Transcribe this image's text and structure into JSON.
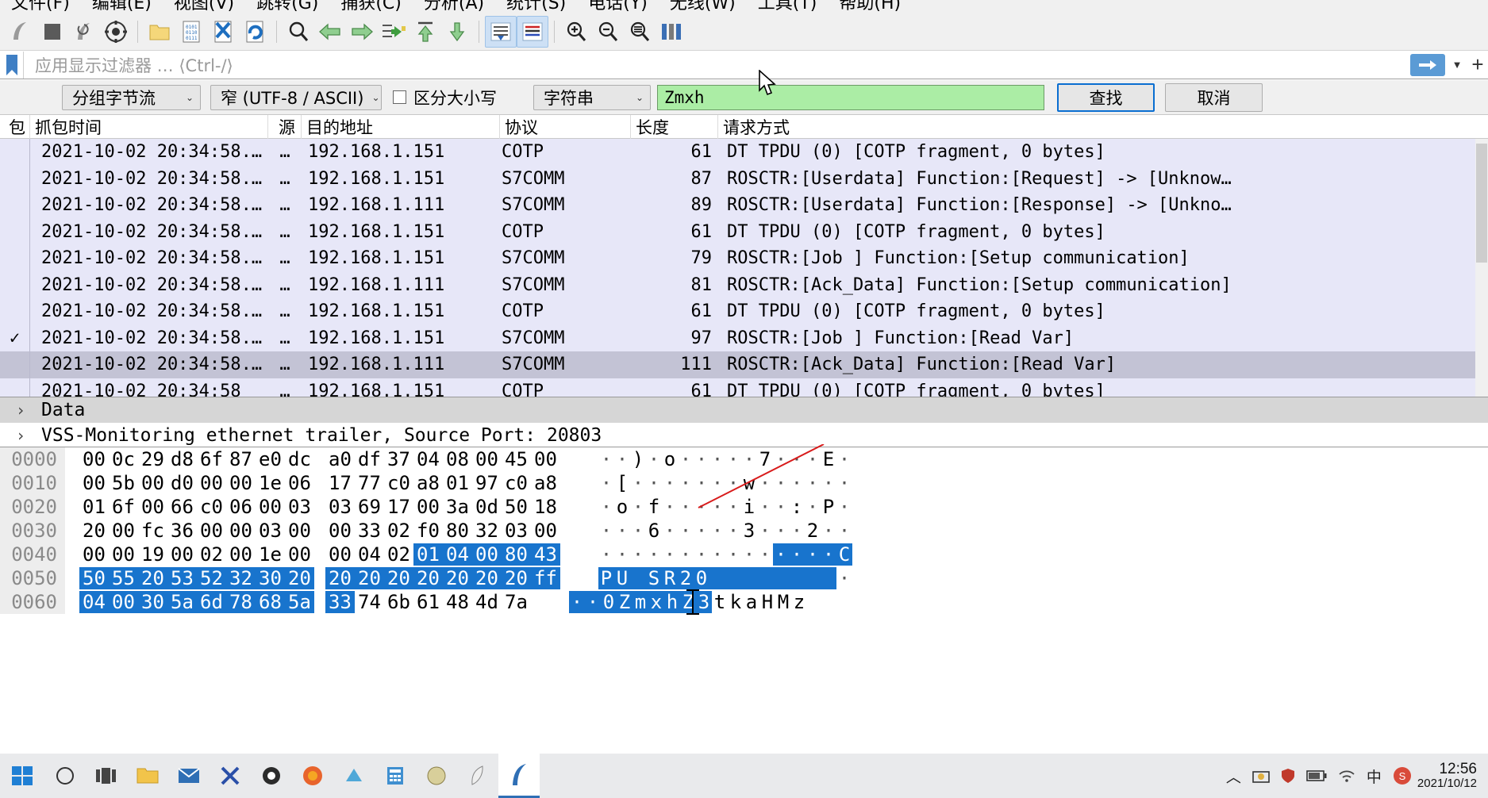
{
  "menu": {
    "items": [
      {
        "label": "文件(F)"
      },
      {
        "label": "编辑(E)"
      },
      {
        "label": "视图(V)"
      },
      {
        "label": "跳转(G)"
      },
      {
        "label": "捕获(C)"
      },
      {
        "label": "分析(A)"
      },
      {
        "label": "统计(S)"
      },
      {
        "label": "电话(Y)"
      },
      {
        "label": "无线(W)"
      },
      {
        "label": "工具(T)"
      },
      {
        "label": "帮助(H)"
      }
    ]
  },
  "toolbar": {
    "buttons": [
      {
        "name": "start-capture-icon",
        "glyph": "shark-fin"
      },
      {
        "name": "stop-capture-icon",
        "glyph": "stop"
      },
      {
        "name": "restart-capture-icon",
        "glyph": "restart"
      },
      {
        "name": "capture-options-icon",
        "glyph": "gear"
      },
      {
        "name": "open-file-icon",
        "glyph": "folder"
      },
      {
        "name": "save-file-icon",
        "glyph": "save"
      },
      {
        "name": "close-file-icon",
        "glyph": "close-x"
      },
      {
        "name": "reload-file-icon",
        "glyph": "reload"
      },
      {
        "name": "find-packet-icon",
        "glyph": "magnifier"
      },
      {
        "name": "go-back-icon",
        "glyph": "arrow-left"
      },
      {
        "name": "go-forward-icon",
        "glyph": "arrow-right"
      },
      {
        "name": "go-to-packet-icon",
        "glyph": "goto"
      },
      {
        "name": "go-first-packet-icon",
        "glyph": "arrow-up-bar"
      },
      {
        "name": "go-last-packet-icon",
        "glyph": "arrow-down"
      },
      {
        "name": "auto-scroll-icon",
        "glyph": "autoscroll"
      },
      {
        "name": "colorize-icon",
        "glyph": "colorize"
      },
      {
        "name": "zoom-in-icon",
        "glyph": "zoom-in"
      },
      {
        "name": "zoom-out-icon",
        "glyph": "zoom-out"
      },
      {
        "name": "zoom-reset-icon",
        "glyph": "zoom-reset"
      },
      {
        "name": "resize-columns-icon",
        "glyph": "columns"
      }
    ]
  },
  "filter": {
    "placeholder": "应用显示过滤器 … ⟨Ctrl-/⟩",
    "value": ""
  },
  "find": {
    "search_in_label": "分组字节流",
    "charset_label": "窄 (UTF-8 / ASCII)",
    "case_sensitive_label": "区分大小写",
    "case_sensitive_checked": false,
    "value_type_label": "字符串",
    "query": "Zmxh",
    "find_button": "查找",
    "cancel_button": "取消",
    "field_bg": "#abeda5"
  },
  "packet_list": {
    "columns": [
      "包",
      "抓包时间",
      "源",
      "目的地址",
      "协议",
      "长度",
      "请求方式"
    ],
    "rows": [
      {
        "time": "2021-10-02 20:34:58.…",
        "src": "…",
        "dst": "192.168.1.151",
        "proto": "COTP",
        "len": "61",
        "info": "DT TPDU (0) [COTP fragment, 0 bytes]",
        "selected": false,
        "mark": ""
      },
      {
        "time": "2021-10-02 20:34:58.…",
        "src": "…",
        "dst": "192.168.1.151",
        "proto": "S7COMM",
        "len": "87",
        "info": "ROSCTR:[Userdata] Function:[Request] -> [Unknow…",
        "selected": false,
        "mark": ""
      },
      {
        "time": "2021-10-02 20:34:58.…",
        "src": "…",
        "dst": "192.168.1.111",
        "proto": "S7COMM",
        "len": "89",
        "info": "ROSCTR:[Userdata] Function:[Response] -> [Unkno…",
        "selected": false,
        "mark": ""
      },
      {
        "time": "2021-10-02 20:34:58.…",
        "src": "…",
        "dst": "192.168.1.151",
        "proto": "COTP",
        "len": "61",
        "info": "DT TPDU (0) [COTP fragment, 0 bytes]",
        "selected": false,
        "mark": ""
      },
      {
        "time": "2021-10-02 20:34:58.…",
        "src": "…",
        "dst": "192.168.1.151",
        "proto": "S7COMM",
        "len": "79",
        "info": "ROSCTR:[Job     ] Function:[Setup communication]",
        "selected": false,
        "mark": ""
      },
      {
        "time": "2021-10-02 20:34:58.…",
        "src": "…",
        "dst": "192.168.1.111",
        "proto": "S7COMM",
        "len": "81",
        "info": "ROSCTR:[Ack_Data] Function:[Setup communication]",
        "selected": false,
        "mark": ""
      },
      {
        "time": "2021-10-02 20:34:58.…",
        "src": "…",
        "dst": "192.168.1.151",
        "proto": "COTP",
        "len": "61",
        "info": "DT TPDU (0) [COTP fragment, 0 bytes]",
        "selected": false,
        "mark": ""
      },
      {
        "time": "2021-10-02 20:34:58.…",
        "src": "…",
        "dst": "192.168.1.151",
        "proto": "S7COMM",
        "len": "97",
        "info": "ROSCTR:[Job     ] Function:[Read Var]",
        "selected": false,
        "mark": "✓"
      },
      {
        "time": "2021-10-02 20:34:58.…",
        "src": "…",
        "dst": "192.168.1.111",
        "proto": "S7COMM",
        "len": "111",
        "info": "ROSCTR:[Ack_Data] Function:[Read Var]",
        "selected": true,
        "mark": ""
      },
      {
        "time": "2021-10-02 20:34:58",
        "src": "…",
        "dst": "192.168.1.151",
        "proto": "COTP",
        "len": "61",
        "info": "DT TPDU (0) [COTP fragment, 0 bytes]",
        "selected": false,
        "mark": ""
      }
    ]
  },
  "packet_detail": {
    "rows": [
      {
        "arrow": "›",
        "label": "Data",
        "selected": true
      },
      {
        "arrow": "›",
        "label": "VSS-Monitoring ethernet trailer, Source Port: 20803",
        "selected": false
      }
    ]
  },
  "hex_dump": {
    "rows": [
      {
        "offset": "0000",
        "bytes": [
          "00",
          "0c",
          "29",
          "d8",
          "6f",
          "87",
          "e0",
          "dc",
          "a0",
          "df",
          "37",
          "04",
          "08",
          "00",
          "45",
          "00"
        ],
        "hl": [],
        "ascii": [
          "·",
          "·",
          ")",
          "·",
          "o",
          "·",
          "·",
          "·",
          "·",
          "·",
          "7",
          "·",
          "·",
          "·",
          "E",
          "·"
        ],
        "ascii_hl": []
      },
      {
        "offset": "0010",
        "bytes": [
          "00",
          "5b",
          "00",
          "d0",
          "00",
          "00",
          "1e",
          "06",
          "17",
          "77",
          "c0",
          "a8",
          "01",
          "97",
          "c0",
          "a8"
        ],
        "hl": [],
        "ascii": [
          "·",
          "[",
          "·",
          "·",
          "·",
          "·",
          "·",
          "·",
          "·",
          "w",
          "·",
          "·",
          "·",
          "·",
          "·",
          "·"
        ],
        "ascii_hl": []
      },
      {
        "offset": "0020",
        "bytes": [
          "01",
          "6f",
          "00",
          "66",
          "c0",
          "06",
          "00",
          "03",
          "03",
          "69",
          "17",
          "00",
          "3a",
          "0d",
          "50",
          "18"
        ],
        "hl": [],
        "ascii": [
          "·",
          "o",
          "·",
          "f",
          "·",
          "·",
          "·",
          "·",
          "·",
          "i",
          "·",
          "·",
          ":",
          "·",
          "P",
          "·"
        ],
        "ascii_hl": []
      },
      {
        "offset": "0030",
        "bytes": [
          "20",
          "00",
          "fc",
          "36",
          "00",
          "00",
          "03",
          "00",
          "00",
          "33",
          "02",
          "f0",
          "80",
          "32",
          "03",
          "00"
        ],
        "hl": [],
        "ascii": [
          "·",
          "·",
          "·",
          "6",
          "·",
          "·",
          "·",
          "·",
          "·",
          "3",
          "·",
          "·",
          "·",
          "2",
          "·",
          "·"
        ],
        "ascii_hl": []
      },
      {
        "offset": "0040",
        "bytes": [
          "00",
          "00",
          "19",
          "00",
          "02",
          "00",
          "1e",
          "00",
          "00",
          "04",
          "02",
          "01",
          "04",
          "00",
          "80",
          "43"
        ],
        "hl": [
          11,
          12,
          13,
          14,
          15
        ],
        "ascii": [
          "·",
          "·",
          "·",
          "·",
          "·",
          "·",
          "·",
          "·",
          "·",
          "·",
          "·",
          "·",
          "·",
          "·",
          "·",
          "C"
        ],
        "ascii_hl": [
          11,
          12,
          13,
          14,
          15
        ]
      },
      {
        "offset": "0050",
        "bytes": [
          "50",
          "55",
          "20",
          "53",
          "52",
          "32",
          "30",
          "20",
          "20",
          "20",
          "20",
          "20",
          "20",
          "20",
          "20",
          "ff"
        ],
        "hl": [
          0,
          1,
          2,
          3,
          4,
          5,
          6,
          7,
          8,
          9,
          10,
          11,
          12,
          13,
          14,
          15
        ],
        "ascii": [
          "P",
          "U",
          " ",
          "S",
          "R",
          "2",
          "0",
          " ",
          " ",
          " ",
          " ",
          " ",
          " ",
          " ",
          " ",
          "·"
        ],
        "ascii_hl": [
          0,
          1,
          2,
          3,
          4,
          5,
          6,
          7,
          8,
          9,
          10,
          11,
          12,
          13,
          14
        ]
      },
      {
        "offset": "0060",
        "bytes": [
          "04",
          "00",
          "30",
          "5a",
          "6d",
          "78",
          "68",
          "5a",
          "33",
          "74",
          "6b",
          "61",
          "48",
          "4d",
          "7a"
        ],
        "hl": [
          0,
          1,
          2,
          3,
          4,
          5,
          6,
          7,
          8
        ],
        "boxed": [
          5
        ],
        "ascii": [
          "·",
          "·",
          "0",
          "Z",
          "m",
          "x",
          "h",
          "Z",
          "3",
          "t",
          "k",
          "a",
          "H",
          "M",
          "z"
        ],
        "ascii_hl": [
          0,
          1,
          2,
          3,
          4,
          5,
          6,
          7,
          8
        ]
      }
    ]
  },
  "taskbar": {
    "icons": [
      {
        "name": "start-button-icon"
      },
      {
        "name": "search-circle-icon"
      },
      {
        "name": "task-view-icon"
      },
      {
        "name": "file-explorer-icon"
      },
      {
        "name": "mail-icon"
      },
      {
        "name": "xmind-icon"
      },
      {
        "name": "github-desktop-icon"
      },
      {
        "name": "firefox-icon"
      },
      {
        "name": "notepad-icon"
      },
      {
        "name": "calculator-icon"
      },
      {
        "name": "photoshop-icon"
      },
      {
        "name": "feather-editor-icon"
      },
      {
        "name": "wireshark-icon"
      }
    ],
    "tray": {
      "chevron": "︿",
      "ime_label": "中",
      "sogou_label": "S",
      "time": "12:56",
      "date": "2021/10/12"
    }
  }
}
